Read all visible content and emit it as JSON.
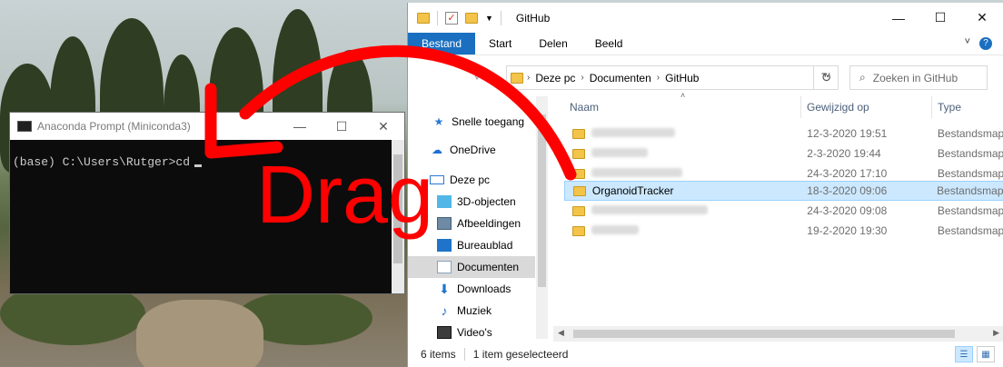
{
  "console": {
    "title": "Anaconda Prompt (Miniconda3)",
    "prompt_line": "(base) C:\\Users\\Rutger>cd",
    "controls": {
      "minimize": "—",
      "maximize": "☐",
      "close": "✕"
    }
  },
  "explorer": {
    "title": "GitHub",
    "controls": {
      "minimize": "—",
      "maximize": "☐",
      "close": "✕"
    },
    "ribbon": {
      "tabs": [
        "Bestand",
        "Start",
        "Delen",
        "Beeld"
      ],
      "active_tab": "Bestand"
    },
    "address": {
      "crumbs": [
        "Deze pc",
        "Documenten",
        "GitHub"
      ]
    },
    "search": {
      "placeholder": "Zoeken in GitHub"
    },
    "nav": [
      {
        "label": "Snelle toegang",
        "icon": "star-icon"
      },
      {
        "label": "OneDrive",
        "icon": "cloud-icon"
      },
      {
        "label": "Deze pc",
        "icon": "computer-icon"
      },
      {
        "label": "3D-objecten",
        "icon": "cube-icon"
      },
      {
        "label": "Afbeeldingen",
        "icon": "pictures-icon"
      },
      {
        "label": "Bureaublad",
        "icon": "desktop-icon"
      },
      {
        "label": "Documenten",
        "icon": "document-icon",
        "selected": true
      },
      {
        "label": "Downloads",
        "icon": "download-icon"
      },
      {
        "label": "Muziek",
        "icon": "music-icon"
      },
      {
        "label": "Video's",
        "icon": "video-icon"
      }
    ],
    "columns": {
      "name": "Naam",
      "modified": "Gewijzigd op",
      "type": "Type"
    },
    "files": [
      {
        "name": "",
        "modified": "12-3-2020 19:51",
        "type": "Bestandsmap",
        "blurred": true
      },
      {
        "name": "",
        "modified": "2-3-2020 19:44",
        "type": "Bestandsmap",
        "blurred": true
      },
      {
        "name": "",
        "modified": "24-3-2020 17:10",
        "type": "Bestandsmap",
        "blurred": true
      },
      {
        "name": "OrganoidTracker",
        "modified": "18-3-2020 09:06",
        "type": "Bestandsmap",
        "selected": true
      },
      {
        "name": "",
        "modified": "24-3-2020 09:08",
        "type": "Bestandsmap",
        "blurred": true
      },
      {
        "name": "",
        "modified": "19-2-2020 19:30",
        "type": "Bestandsmap",
        "blurred": true
      }
    ],
    "status": {
      "items": "6 items",
      "selection": "1 item geselecteerd"
    }
  },
  "annotation": {
    "text": "Drag",
    "color": "#ff0000"
  }
}
